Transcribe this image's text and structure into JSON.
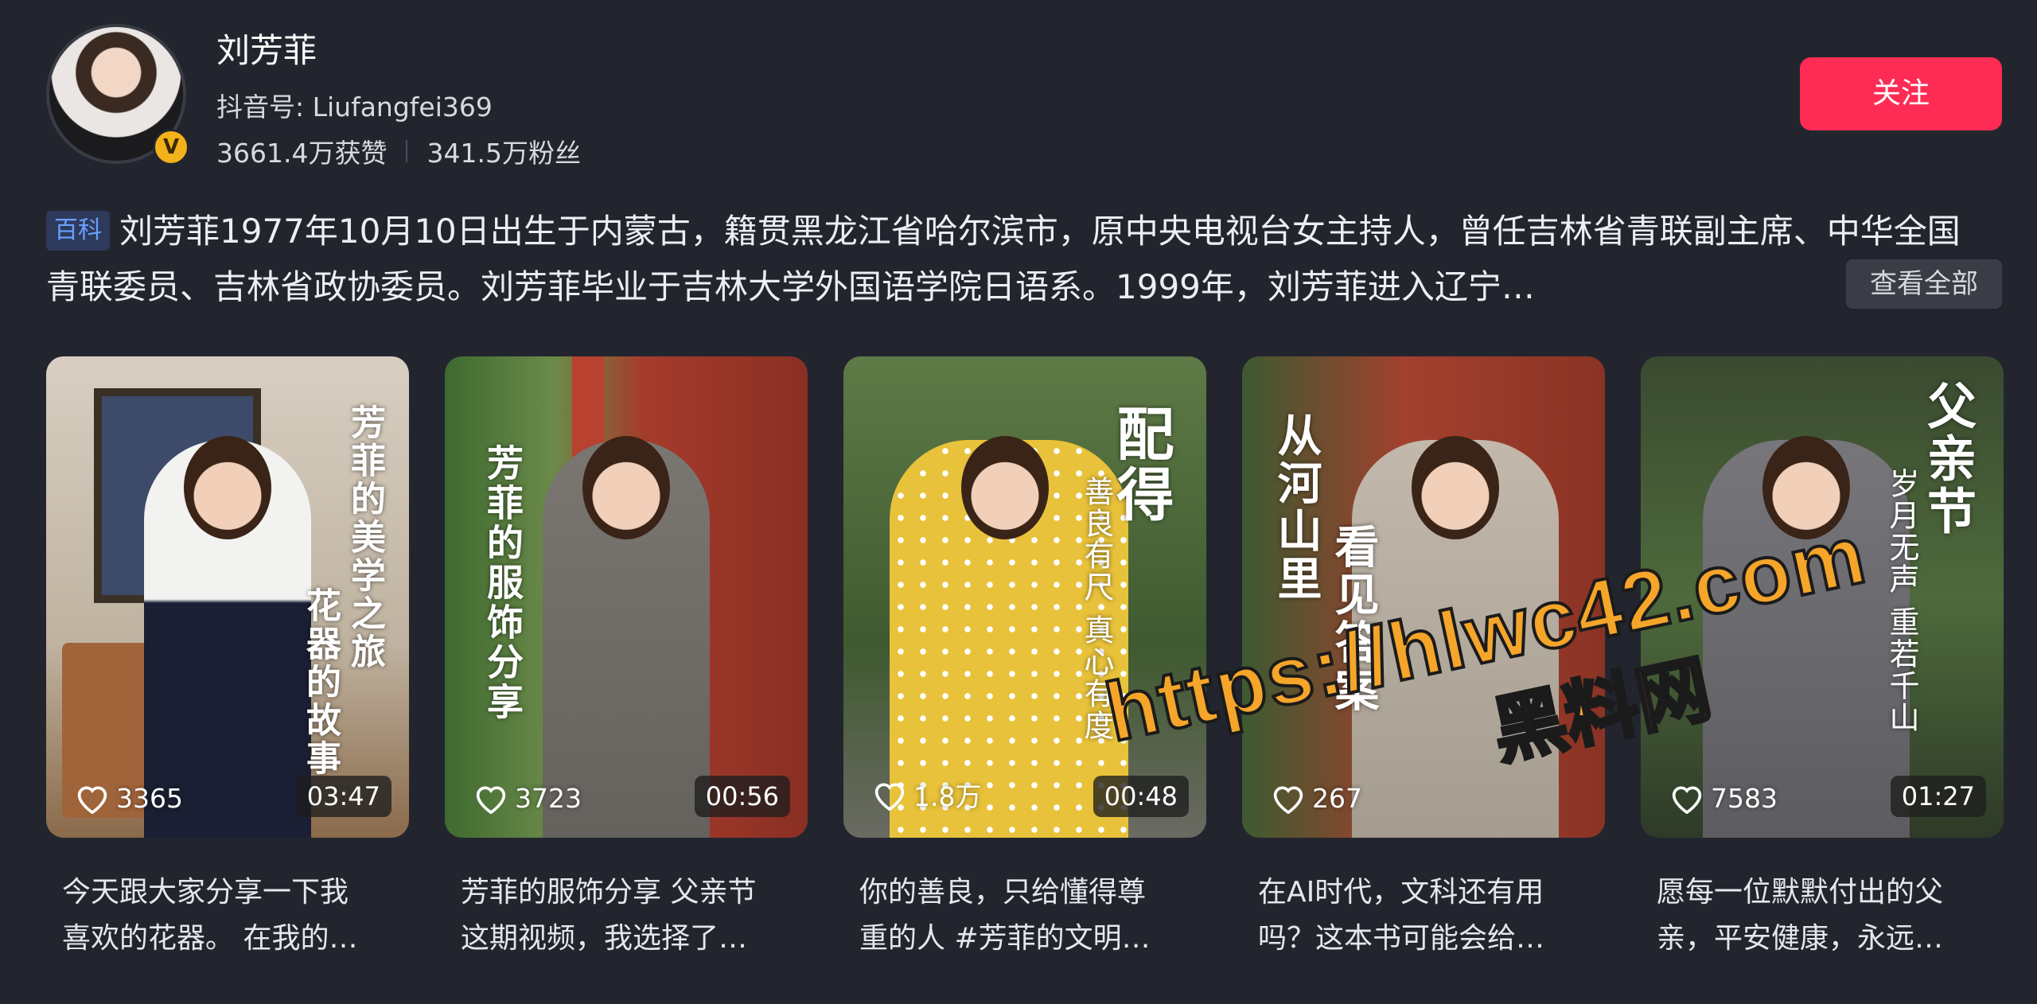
{
  "profile": {
    "name": "刘芳菲",
    "handle": "抖音号: Liufangfei369",
    "likes": "3661.4万获赞",
    "fans": "341.5万粉丝",
    "verified_badge": "V",
    "follow_label": "关注"
  },
  "bio": {
    "tag": "百科",
    "text": "刘芳菲1977年10月10日出生于内蒙古，籍贯黑龙江省哈尔滨市，原中央电视台女主持人，曾任吉林省青联副主席、中华全国青联委员、吉林省政协委员。刘芳菲毕业于吉林大学外国语学院日语系。1999年，刘芳菲进入辽宁…",
    "more_label": "查看全部"
  },
  "videos": [
    {
      "likes": "3365",
      "duration": "03:47",
      "overlay_main": "芳菲的美学之旅",
      "overlay_sub": "花器的故事",
      "caption_line1": "今天跟大家分享一下我",
      "caption_line2": "喜欢的花器。 在我的…",
      "bg": "#c9bfb0",
      "dress": "#1a1f33"
    },
    {
      "likes": "3723",
      "duration": "00:56",
      "overlay_main": "芳菲的服饰分享",
      "overlay_sub": "",
      "caption_line1": "芳菲的服饰分享 父亲节",
      "caption_line2": "这期视频，我选择了…",
      "bg": "#9c3a2c",
      "dress": "#6e6a66"
    },
    {
      "likes": "1.8万",
      "duration": "00:48",
      "overlay_main": "配得",
      "overlay_sub": "善良有尺 真心有度",
      "caption_line1": "你的善良，只给懂得尊",
      "caption_line2": "重的人 #芳菲的文明…",
      "bg": "#4d6a3a",
      "dress": "#e8c23a"
    },
    {
      "likes": "267",
      "duration": "",
      "overlay_main": "从河山里",
      "overlay_sub": "看见答案",
      "caption_line1": "在AI时代，文科还有用",
      "caption_line2": "吗？这本书可能会给…",
      "bg": "#8a3a2a",
      "dress": "#b8aea2"
    },
    {
      "likes": "7583",
      "duration": "01:27",
      "overlay_main": "父亲节",
      "overlay_sub": "岁月无声 重若千山",
      "caption_line1": "愿每一位默默付出的父",
      "caption_line2": "亲，平安健康，永远…",
      "bg": "#3d5a36",
      "dress": "#6b6a6e"
    }
  ],
  "watermark": {
    "url": "https://hlwc42.com",
    "name": "黑料网"
  },
  "colors": {
    "background": "#23252e",
    "follow_button": "#fe2c55",
    "tag_text": "#6aa0ff",
    "watermark": "#f5a52a"
  },
  "icons": [
    "heart-icon",
    "verified-icon"
  ]
}
